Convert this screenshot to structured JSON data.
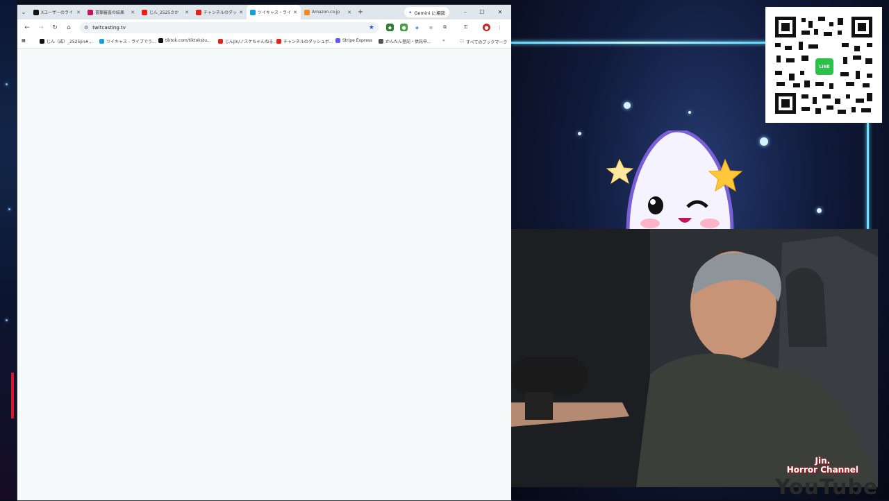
{
  "browser": {
    "tabs": [
      {
        "label": "Xユーザーのライ",
        "icon": "x-logo-icon",
        "color": "#111111",
        "active": false
      },
      {
        "label": "書類審査の結果",
        "icon": "doc-icon",
        "color": "#c2185b",
        "active": false
      },
      {
        "label": "じん_2525さか",
        "icon": "youtube-icon",
        "color": "#e62117",
        "active": false
      },
      {
        "label": "チャンネルのダッ",
        "icon": "youtube-icon",
        "color": "#e62117",
        "active": false
      },
      {
        "label": "ツイキャス・ライ",
        "icon": "twitcasting-icon",
        "color": "#18a0d8",
        "active": true
      },
      {
        "label": "Amazon.co.jp",
        "icon": "amazon-icon",
        "color": "#f08a1c",
        "active": false
      }
    ],
    "new_tab": "+",
    "gemini_label": "Gemini に相談",
    "url": "twitcasting.tv",
    "bookmarks": [
      {
        "label": "じん（成）_2525Jin#...",
        "icon": "x-logo-icon",
        "color": "#111111"
      },
      {
        "label": "ツイキャス - ライブでう...",
        "icon": "twitcasting-icon",
        "color": "#18a0d8"
      },
      {
        "label": "tiktok.com/tiktokstu...",
        "icon": "tiktok-icon",
        "color": "#111111"
      },
      {
        "label": "じんJin/ノスケちゃんねる...",
        "icon": "youtube-icon",
        "color": "#e62117"
      },
      {
        "label": "チャンネルのダッシュボ...",
        "icon": "youtube-icon",
        "color": "#e62117"
      },
      {
        "label": "Stripe Express",
        "icon": "stripe-icon",
        "color": "#635bff"
      },
      {
        "label": "かんたん登記・供託申...",
        "icon": "globe-icon",
        "color": "#555555"
      }
    ],
    "more_bookmarks": "»",
    "all_bookmarks": "すべてのブックマーク"
  },
  "overlay": {
    "qr_badge": "LINE",
    "channel_name_line1": "Jin.",
    "channel_name_line2": "Horror Channel",
    "youtube_text": "YouTube"
  }
}
